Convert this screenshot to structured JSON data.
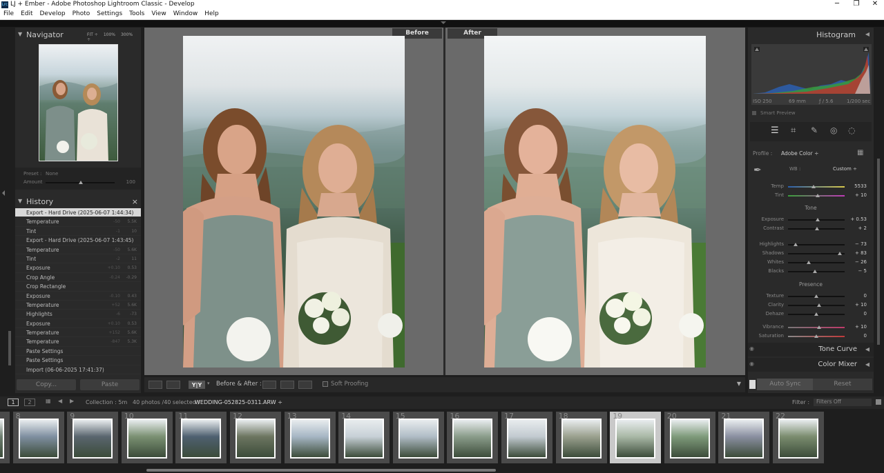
{
  "window": {
    "title": "LJ + Ember - Adobe Photoshop Lightroom Classic - Develop",
    "app_icon": "Lrc"
  },
  "menu": [
    "File",
    "Edit",
    "Develop",
    "Photo",
    "Settings",
    "Tools",
    "View",
    "Window",
    "Help"
  ],
  "navigator": {
    "title": "Navigator",
    "zoom_options": [
      "FIT ÷",
      "100%",
      "300% ÷"
    ],
    "preset_label": "Preset :",
    "preset_value": "None",
    "amount_label": "Amount",
    "amount_value": "100"
  },
  "history": {
    "title": "History",
    "close": "×",
    "items": [
      {
        "label": "Export - Hard Drive (2025-06-07 1:44:34)",
        "v1": "",
        "v2": "",
        "selected": true
      },
      {
        "label": "Temperature",
        "v1": "-50",
        "v2": "5.5K"
      },
      {
        "label": "Tint",
        "v1": "-1",
        "v2": "10"
      },
      {
        "label": "Export - Hard Drive (2025-06-07 1:43:45)",
        "v1": "",
        "v2": ""
      },
      {
        "label": "Temperature",
        "v1": "-50",
        "v2": "5.6K"
      },
      {
        "label": "Tint",
        "v1": "-2",
        "v2": "11"
      },
      {
        "label": "Exposure",
        "v1": "+0.10",
        "v2": "0.53"
      },
      {
        "label": "Crop Angle",
        "v1": "-0.24",
        "v2": "-0.29"
      },
      {
        "label": "Crop Rectangle",
        "v1": "",
        "v2": ""
      },
      {
        "label": "Exposure",
        "v1": "-0.10",
        "v2": "0.43"
      },
      {
        "label": "Temperature",
        "v1": "+52",
        "v2": "5.6K"
      },
      {
        "label": "Highlights",
        "v1": "-6",
        "v2": "-73"
      },
      {
        "label": "Exposure",
        "v1": "+0.10",
        "v2": "0.53"
      },
      {
        "label": "Temperature",
        "v1": "+152",
        "v2": "5.6K"
      },
      {
        "label": "Temperature",
        "v1": "-847",
        "v2": "5.3K"
      },
      {
        "label": "Paste Settings",
        "v1": "",
        "v2": ""
      },
      {
        "label": "Paste Settings",
        "v1": "",
        "v2": ""
      },
      {
        "label": "Import (06-06-2025 17:41:37)",
        "v1": "",
        "v2": ""
      }
    ],
    "copy_label": "Copy...",
    "paste_label": "Paste"
  },
  "view": {
    "before_label": "Before",
    "after_label": "After",
    "mode_label": "Before & After :",
    "yy_label": "Y|Y",
    "soft_proofing_label": "Soft Proofing"
  },
  "histogram": {
    "title": "Histogram",
    "iso": "ISO 250",
    "focal": "69 mm",
    "aperture": "ƒ / 5.6",
    "shutter": "1/200 sec",
    "smart_preview": "Smart Preview"
  },
  "basic": {
    "profile_label": "Profile :",
    "profile_value": "Adobe Color ÷",
    "wb_label": "WB :",
    "wb_value": "Custom ÷",
    "tone_label": "Tone",
    "presence_label": "Presence",
    "sliders": [
      {
        "label": "Temp",
        "value": "5533",
        "pos": 0.45
      },
      {
        "label": "Tint",
        "value": "+ 10",
        "pos": 0.53
      },
      {
        "label": "Exposure",
        "value": "+ 0.53",
        "pos": 0.53
      },
      {
        "label": "Contrast",
        "value": "+ 2",
        "pos": 0.51
      },
      {
        "label": "Highlights",
        "value": "− 73",
        "pos": 0.14
      },
      {
        "label": "Shadows",
        "value": "+ 83",
        "pos": 0.91
      },
      {
        "label": "Whites",
        "value": "− 26",
        "pos": 0.37
      },
      {
        "label": "Blacks",
        "value": "− 5",
        "pos": 0.47
      },
      {
        "label": "Texture",
        "value": "0",
        "pos": 0.5
      },
      {
        "label": "Clarity",
        "value": "+ 10",
        "pos": 0.55
      },
      {
        "label": "Dehaze",
        "value": "0",
        "pos": 0.5
      },
      {
        "label": "Vibrance",
        "value": "+ 10",
        "pos": 0.55
      },
      {
        "label": "Saturation",
        "value": "0",
        "pos": 0.5
      }
    ],
    "tone_curve": "Tone Curve",
    "color_mixer": "Color Mixer",
    "auto_sync": "Auto Sync",
    "reset": "Reset"
  },
  "filmstrip": {
    "page1": "1",
    "page2": "2",
    "collection": "Collection : 5m",
    "count": "40 photos /40 selected /",
    "filename": "WEDDING-052825-0311.ARW ÷",
    "filter_label": "Filter :",
    "filter_value": "Filters Off",
    "cells": [
      {
        "num": "",
        "light": false
      },
      {
        "num": "8",
        "light": false
      },
      {
        "num": "9",
        "light": false
      },
      {
        "num": "10",
        "light": false
      },
      {
        "num": "11",
        "light": false
      },
      {
        "num": "12",
        "light": false
      },
      {
        "num": "13",
        "light": false
      },
      {
        "num": "14",
        "light": false
      },
      {
        "num": "15",
        "light": false
      },
      {
        "num": "16",
        "light": false
      },
      {
        "num": "17",
        "light": false
      },
      {
        "num": "18",
        "light": false
      },
      {
        "num": "19",
        "light": true
      },
      {
        "num": "20",
        "light": false
      },
      {
        "num": "21",
        "light": false
      },
      {
        "num": "22",
        "light": false
      }
    ]
  },
  "colors": {
    "panel": "#2a2a2a",
    "center_bg": "#6a6a6a",
    "selected_row": "#d8d8d8"
  }
}
